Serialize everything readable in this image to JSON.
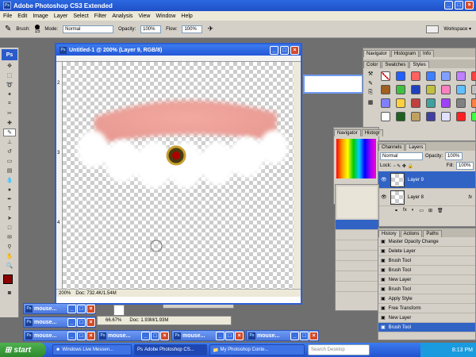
{
  "app": {
    "title": "Adobe Photoshop CS3 Extended",
    "logo": "Ps"
  },
  "menu": [
    "File",
    "Edit",
    "Image",
    "Layer",
    "Select",
    "Filter",
    "Analysis",
    "View",
    "Window",
    "Help"
  ],
  "options": {
    "brush_label": "Brush:",
    "brush_size": "15",
    "mode_label": "Mode:",
    "mode_value": "Normal",
    "opacity_label": "Opacity:",
    "opacity_value": "100%",
    "flow_label": "Flow:",
    "flow_value": "100%",
    "workspace": "Workspace ▾"
  },
  "document": {
    "title": "Untitled-1 @ 200% (Layer 9, RGB/8)",
    "zoom": "200%",
    "doc_info": "Doc: 732.4K/1.54M",
    "ruler_v": [
      "2",
      "3",
      "4"
    ]
  },
  "panels": {
    "navigator_tabs": [
      "Navigator",
      "Histogram",
      "Info"
    ],
    "styles_tabs": [
      "Color",
      "Swatches",
      "Styles"
    ],
    "layers_tabs": [
      "Channels",
      "Layers"
    ],
    "blend_mode": "Normal",
    "opacity_label": "Opacity:",
    "opacity_value": "100%",
    "lock_label": "Lock:",
    "fill_label": "Fill:",
    "fill_value": "100%",
    "layers": [
      "Layer 9",
      "Layer 8"
    ],
    "history_tabs": [
      "History",
      "Actions",
      "Paths"
    ],
    "history": [
      "Master Opacity Change",
      "Delete Layer",
      "Brush Tool",
      "Brush Tool",
      "New Layer",
      "Brush Tool",
      "Apply Style",
      "Free Transform",
      "New Layer",
      "Brush Tool"
    ],
    "small_tabs": [
      "Navigator",
      "Histogr"
    ]
  },
  "minimized": [
    "mouse...",
    "mouse...",
    "mouse...",
    "mouse...",
    "mouse...",
    "mouse..."
  ],
  "small_doc": {
    "zoom": "66.67%",
    "doc_info": "Doc: 1.93M/1.93M"
  },
  "taskbar": {
    "start": "start",
    "items": [
      "Windows Live Messen...",
      "Adobe Photoshop CS...",
      "My Photoshop Conte..."
    ],
    "search": "Search Desktop",
    "clock": "8:13 PM"
  },
  "colors": {
    "accent": "#3163c5",
    "foreground": "#8b0000"
  }
}
